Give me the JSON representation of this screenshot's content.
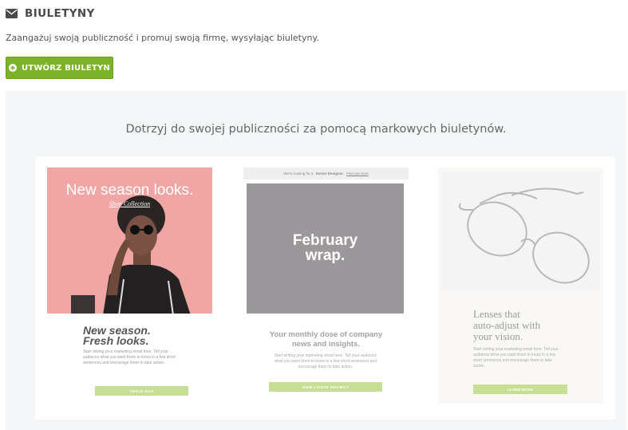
{
  "header": {
    "title": "BIULETYNY",
    "icon": "envelope-icon"
  },
  "subtitle": "Zaangażuj swoją publiczność i promuj swoją firmę, wysyłając biuletyny.",
  "create_button": {
    "label": "UTWÓRZ BIULETYN",
    "icon": "plus-circle-icon"
  },
  "colors": {
    "accent": "#7cb228",
    "card_button": "#c6df95",
    "card1_hero": "#f0a6a5",
    "card2_hero": "#9b979b"
  },
  "panel": {
    "title": "Dotrzyj do swojej publiczności za pomocą markowych biuletynów.",
    "cards": [
      {
        "hero_title": "New season looks.",
        "hero_link": "Shop Collection",
        "heading_line1": "New season.",
        "heading_line2": "Fresh looks.",
        "text": "Start writing your marketing email here. Tell your audience what you want them to know in a few short sentences and encourage them to take action.",
        "button": "CHECK SITE"
      },
      {
        "topbar_text": "We're looking for a",
        "topbar_bold": "Senior Designer.",
        "topbar_link": "Find out more",
        "hero_line1": "February",
        "hero_line2": "wrap.",
        "heading_line1": "Your monthly dose of company",
        "heading_line2": "news and insights.",
        "text": "Start writing your marketing email here. Tell your audience what you want them to know in a few short sentences and encourage them to take action.",
        "button": "VIEW LATEST PROJECT"
      },
      {
        "heading_line1": "Lenses that",
        "heading_line2": "auto-adjust with",
        "heading_line3": "your vision.",
        "text": "Start writing your marketing email here. Tell your audience what you want them to know in a few short sentences and encourage them to take action.",
        "button": "LEARN MORE"
      }
    ]
  }
}
